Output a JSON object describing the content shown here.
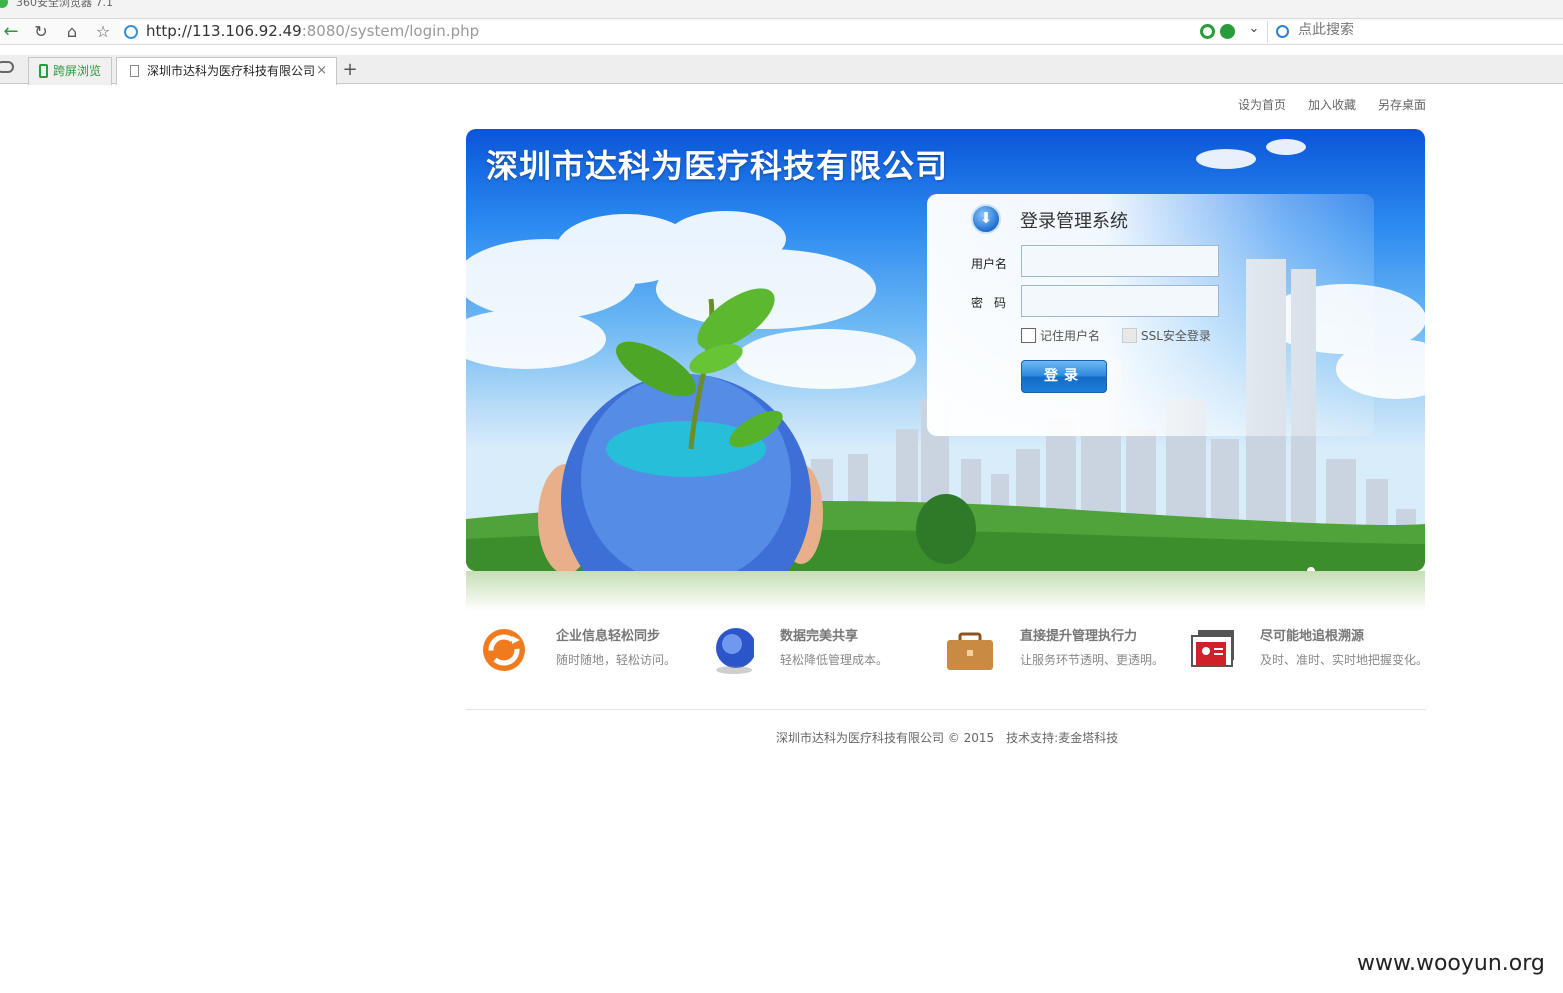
{
  "browser": {
    "app_title": "360安全浏览器 7.1",
    "url_host": "http://113.106.92.49",
    "url_rest": ":8080/system/login.php",
    "search_placeholder": "点此搜索",
    "tabs": [
      {
        "label": "跨屏浏览"
      },
      {
        "label": "深圳市达科为医疗科技有限公司"
      }
    ],
    "new_tab_label": "+",
    "close_label": "×"
  },
  "top_links": [
    "设为首页",
    "加入收藏",
    "另存桌面"
  ],
  "banner": {
    "company_name": "深圳市达科为医疗科技有限公司"
  },
  "login": {
    "title": "登录管理系统",
    "username_label": "用户名",
    "password_label": "密码",
    "username_value": "",
    "password_value": "",
    "remember_label": "记住用户名",
    "ssl_label": "SSL安全登录",
    "submit_label": "登录"
  },
  "features": [
    {
      "title": "企业信息轻松同步",
      "desc": "随时随地，轻松访问。",
      "icon": "sync-icon"
    },
    {
      "title": "数据完美共享",
      "desc": "轻松降低管理成本。",
      "icon": "globe-icon"
    },
    {
      "title": "直接提升管理执行力",
      "desc": "让服务环节透明、更透明。",
      "icon": "briefcase-icon"
    },
    {
      "title": "尽可能地追根溯源",
      "desc": "及时、准时、实时地把握变化。",
      "icon": "id-card-icon"
    }
  ],
  "footer": {
    "copyright": "深圳市达科为医疗科技有限公司 © 2015",
    "support": "技术支持:麦金塔科技"
  },
  "watermark": "www.wooyun.org",
  "colors": {
    "brand_blue": "#1b7fd8",
    "browser_green": "#2a9b3a"
  }
}
